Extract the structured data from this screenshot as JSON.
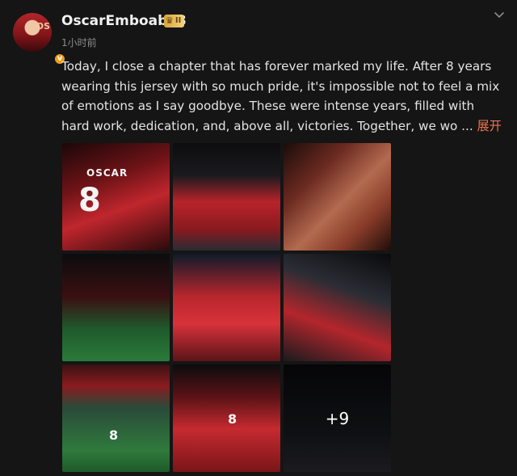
{
  "post": {
    "user": {
      "username": "OscarEmboaba8",
      "avatar_text": "OS",
      "verified_badge": "v",
      "vip_level": "II",
      "vip_icon": "crown-icon"
    },
    "timestamp": "1小时前",
    "text": "Today, I close a chapter that has forever marked my life. After 8 years wearing this jersey with so much pride, it's impossible not to feel a mix of emotions as I say goodbye. These were intense years, filled with hard work, dedication, and, above all, victories. Together, we wo  ...",
    "expand_label": "展开",
    "photos": [
      {
        "shirt_name": "OSCAR",
        "shirt_number": "8"
      },
      {
        "shirt_name": "",
        "shirt_number": ""
      },
      {
        "shirt_name": "",
        "shirt_number": ""
      },
      {
        "shirt_name": "",
        "shirt_number": ""
      },
      {
        "shirt_name": "",
        "shirt_number": ""
      },
      {
        "shirt_name": "",
        "shirt_number": ""
      },
      {
        "shirt_name": "",
        "shirt_number": "8"
      },
      {
        "shirt_name": "",
        "shirt_number": "8"
      },
      {
        "shirt_name": "",
        "shirt_number": ""
      }
    ],
    "more_photos_label": "+9"
  },
  "colors": {
    "background": "#151515",
    "link": "#eb7350",
    "vip_gold": "#f2d27a",
    "verified": "#f29b1b"
  },
  "icons": {
    "menu": "chevron-down-icon"
  }
}
